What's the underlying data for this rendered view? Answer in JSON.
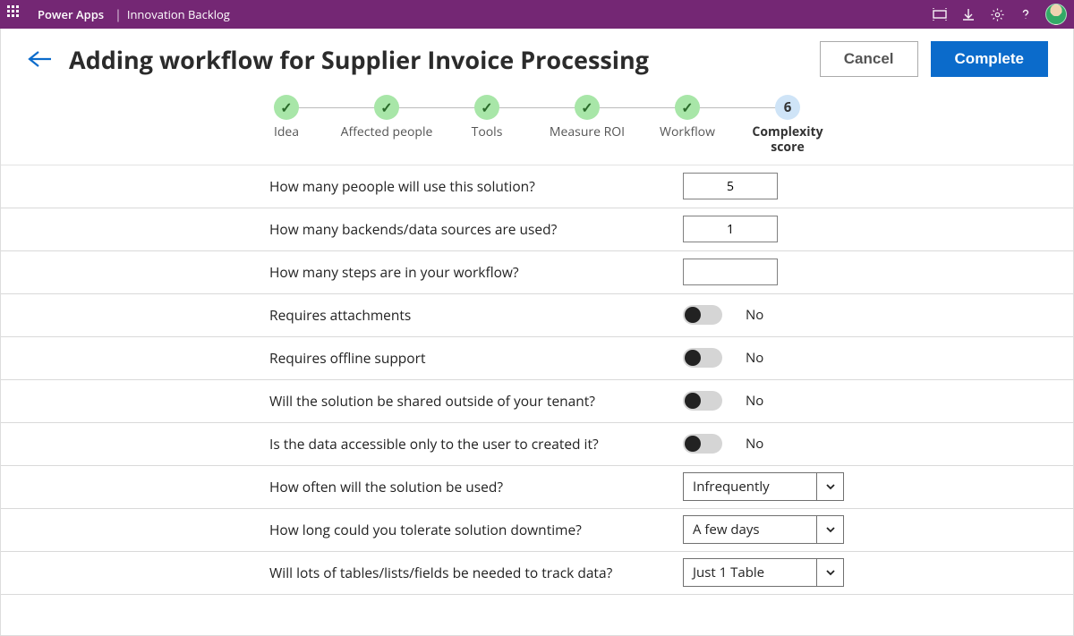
{
  "appbar": {
    "brand": "Power Apps",
    "separator": "|",
    "app_name": "Innovation Backlog"
  },
  "header": {
    "title": "Adding workflow for Supplier Invoice Processing",
    "cancel_label": "Cancel",
    "complete_label": "Complete"
  },
  "stepper": {
    "steps": [
      {
        "label": "Idea",
        "state": "done"
      },
      {
        "label": "Affected people",
        "state": "done"
      },
      {
        "label": "Tools",
        "state": "done"
      },
      {
        "label": "Measure ROI",
        "state": "done"
      },
      {
        "label": "Workflow",
        "state": "done"
      },
      {
        "label": "Complexity score",
        "state": "current",
        "number": "6"
      }
    ]
  },
  "questions": {
    "q1": {
      "text": "How many peoople will use this solution?",
      "value": "5"
    },
    "q2": {
      "text": "How many backends/data sources are  used?",
      "value": "1"
    },
    "q3": {
      "text": "How many steps are in your workflow?",
      "value": ""
    },
    "q4": {
      "text": "Requires attachments",
      "toggle_label": "No"
    },
    "q5": {
      "text": "Requires offline support",
      "toggle_label": "No"
    },
    "q6": {
      "text": "Will the solution be shared  outside of your tenant?",
      "toggle_label": "No"
    },
    "q7": {
      "text": "Is the data accessible only to the user to created it?",
      "toggle_label": "No"
    },
    "q8": {
      "text": "How often will the solution be used?",
      "value": "Infrequently"
    },
    "q9": {
      "text": "How long could you tolerate solution downtime?",
      "value": "A few days"
    },
    "q10": {
      "text": "Will lots of tables/lists/fields be needed to track data?",
      "value": "Just 1 Table"
    }
  }
}
